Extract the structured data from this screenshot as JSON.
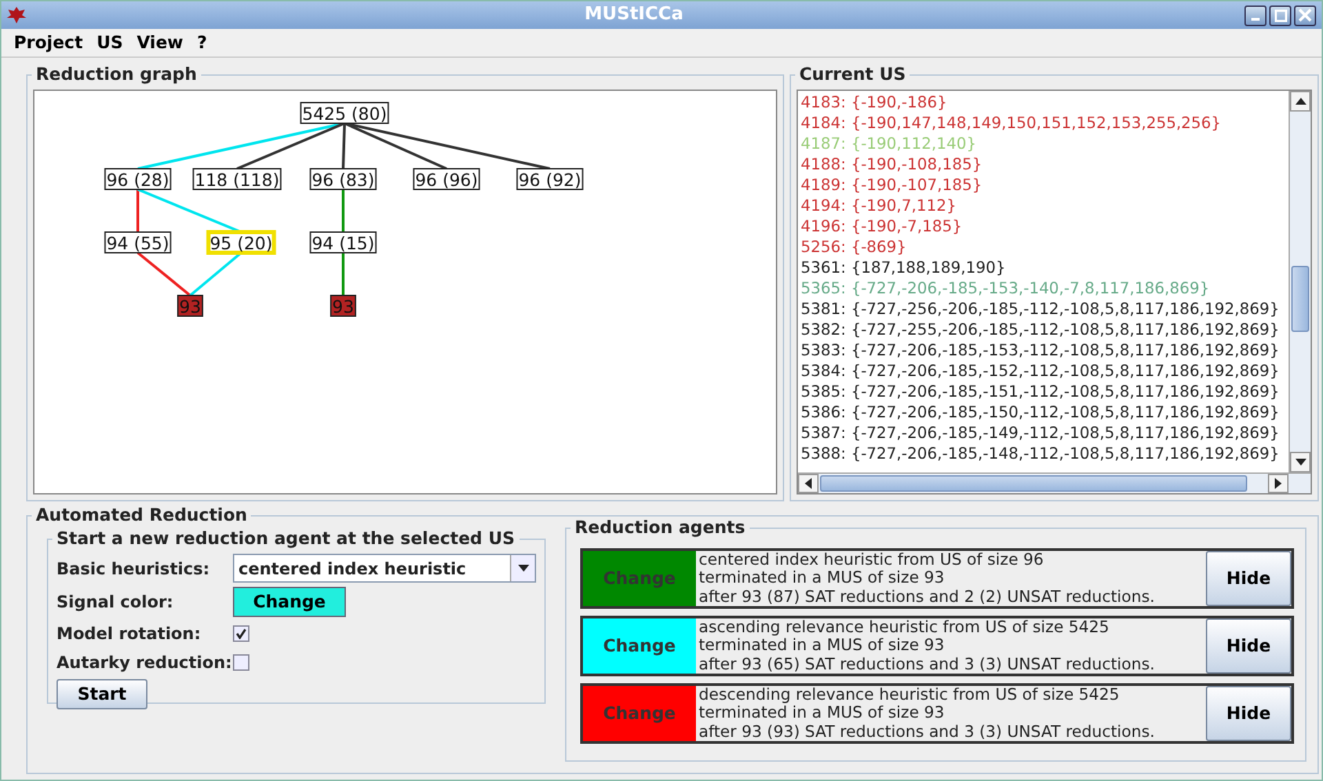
{
  "window": {
    "title": "MUStICCa"
  },
  "menu": [
    "Project",
    "US",
    "View",
    "?"
  ],
  "reduction_graph": {
    "title": "Reduction graph",
    "nodes": [
      {
        "label": "5425 (80)",
        "kind": "us",
        "selected": false
      },
      {
        "label": "96 (28)",
        "kind": "us",
        "selected": false
      },
      {
        "label": "118 (118)",
        "kind": "us",
        "selected": false
      },
      {
        "label": "96 (83)",
        "kind": "us",
        "selected": false
      },
      {
        "label": "96 (96)",
        "kind": "us",
        "selected": false
      },
      {
        "label": "96 (92)",
        "kind": "us",
        "selected": false
      },
      {
        "label": "94 (55)",
        "kind": "us",
        "selected": false
      },
      {
        "label": "95 (20)",
        "kind": "us",
        "selected": true
      },
      {
        "label": "94 (15)",
        "kind": "us",
        "selected": false
      },
      {
        "label": "93",
        "kind": "mus",
        "selected": false
      },
      {
        "label": "93",
        "kind": "mus",
        "selected": false
      }
    ],
    "edges": [
      {
        "color": "#00e5ee"
      },
      {
        "color": "#333333"
      },
      {
        "color": "#333333"
      },
      {
        "color": "#333333"
      },
      {
        "color": "#333333"
      },
      {
        "color": "#ee2222"
      },
      {
        "color": "#00e5ee"
      },
      {
        "color": "#ee2222"
      },
      {
        "color": "#00e5ee"
      },
      {
        "color": "#119911"
      },
      {
        "color": "#119911"
      }
    ]
  },
  "current_us": {
    "title": "Current US",
    "lines": [
      {
        "text": "4183: {-190,-186}",
        "color": "#cc3333"
      },
      {
        "text": "4184: {-190,147,148,149,150,151,152,153,255,256}",
        "color": "#cc3333"
      },
      {
        "text": "4187: {-190,112,140}",
        "color": "#99cc77"
      },
      {
        "text": "4188: {-190,-108,185}",
        "color": "#cc3333"
      },
      {
        "text": "4189: {-190,-107,185}",
        "color": "#cc3333"
      },
      {
        "text": "4194: {-190,7,112}",
        "color": "#cc3333"
      },
      {
        "text": "4196: {-190,-7,185}",
        "color": "#cc3333"
      },
      {
        "text": "5256: {-869}",
        "color": "#cc3333"
      },
      {
        "text": "5361: {187,188,189,190}",
        "color": "#222222"
      },
      {
        "text": "5365: {-727,-206,-185,-153,-140,-7,8,117,186,869}",
        "color": "#66aa88"
      },
      {
        "text": "5381: {-727,-256,-206,-185,-112,-108,5,8,117,186,192,869}",
        "color": "#222222"
      },
      {
        "text": "5382: {-727,-255,-206,-185,-112,-108,5,8,117,186,192,869}",
        "color": "#222222"
      },
      {
        "text": "5383: {-727,-206,-185,-153,-112,-108,5,8,117,186,192,869}",
        "color": "#222222"
      },
      {
        "text": "5384: {-727,-206,-185,-152,-112,-108,5,8,117,186,192,869}",
        "color": "#222222"
      },
      {
        "text": "5385: {-727,-206,-185,-151,-112,-108,5,8,117,186,192,869}",
        "color": "#222222"
      },
      {
        "text": "5386: {-727,-206,-185,-150,-112,-108,5,8,117,186,192,869}",
        "color": "#222222"
      },
      {
        "text": "5387: {-727,-206,-185,-149,-112,-108,5,8,117,186,192,869}",
        "color": "#222222"
      },
      {
        "text": "5388: {-727,-206,-185,-148,-112,-108,5,8,117,186,192,869}",
        "color": "#222222"
      }
    ]
  },
  "automated_reduction": {
    "title": "Automated Reduction",
    "new_agent": {
      "title": "Start a new reduction agent at the selected US",
      "heuristics_label": "Basic heuristics:",
      "heuristics_value": "centered index heuristic",
      "signal_color": {
        "label": "Signal color:",
        "button": "Change",
        "color": "#22eedd"
      },
      "model_rotation_label": "Model rotation:",
      "model_rotation": true,
      "autarky_label": "Autarky reduction:",
      "autarky": false,
      "start_button": "Start"
    },
    "agents_title": "Reduction agents",
    "agents": [
      {
        "color": "#008800",
        "change_button": "Change",
        "lines": [
          "centered index heuristic from US of size 96",
          "terminated in a MUS of size 93",
          "after 93 (87) SAT reductions  and 2 (2) UNSAT reductions."
        ],
        "hide_button": "Hide"
      },
      {
        "color": "#00ffff",
        "change_button": "Change",
        "lines": [
          "ascending relevance heuristic from US of size 5425",
          "terminated in a MUS of size 93",
          "after 93 (65) SAT reductions  and 3 (3) UNSAT reductions."
        ],
        "hide_button": "Hide"
      },
      {
        "color": "#ff0000",
        "change_button": "Change",
        "lines": [
          "descending relevance heuristic from US of size 5425",
          "terminated in a MUS of size 93",
          "after 93 (93) SAT reductions  and 3 (3) UNSAT reductions."
        ],
        "hide_button": "Hide"
      }
    ]
  }
}
